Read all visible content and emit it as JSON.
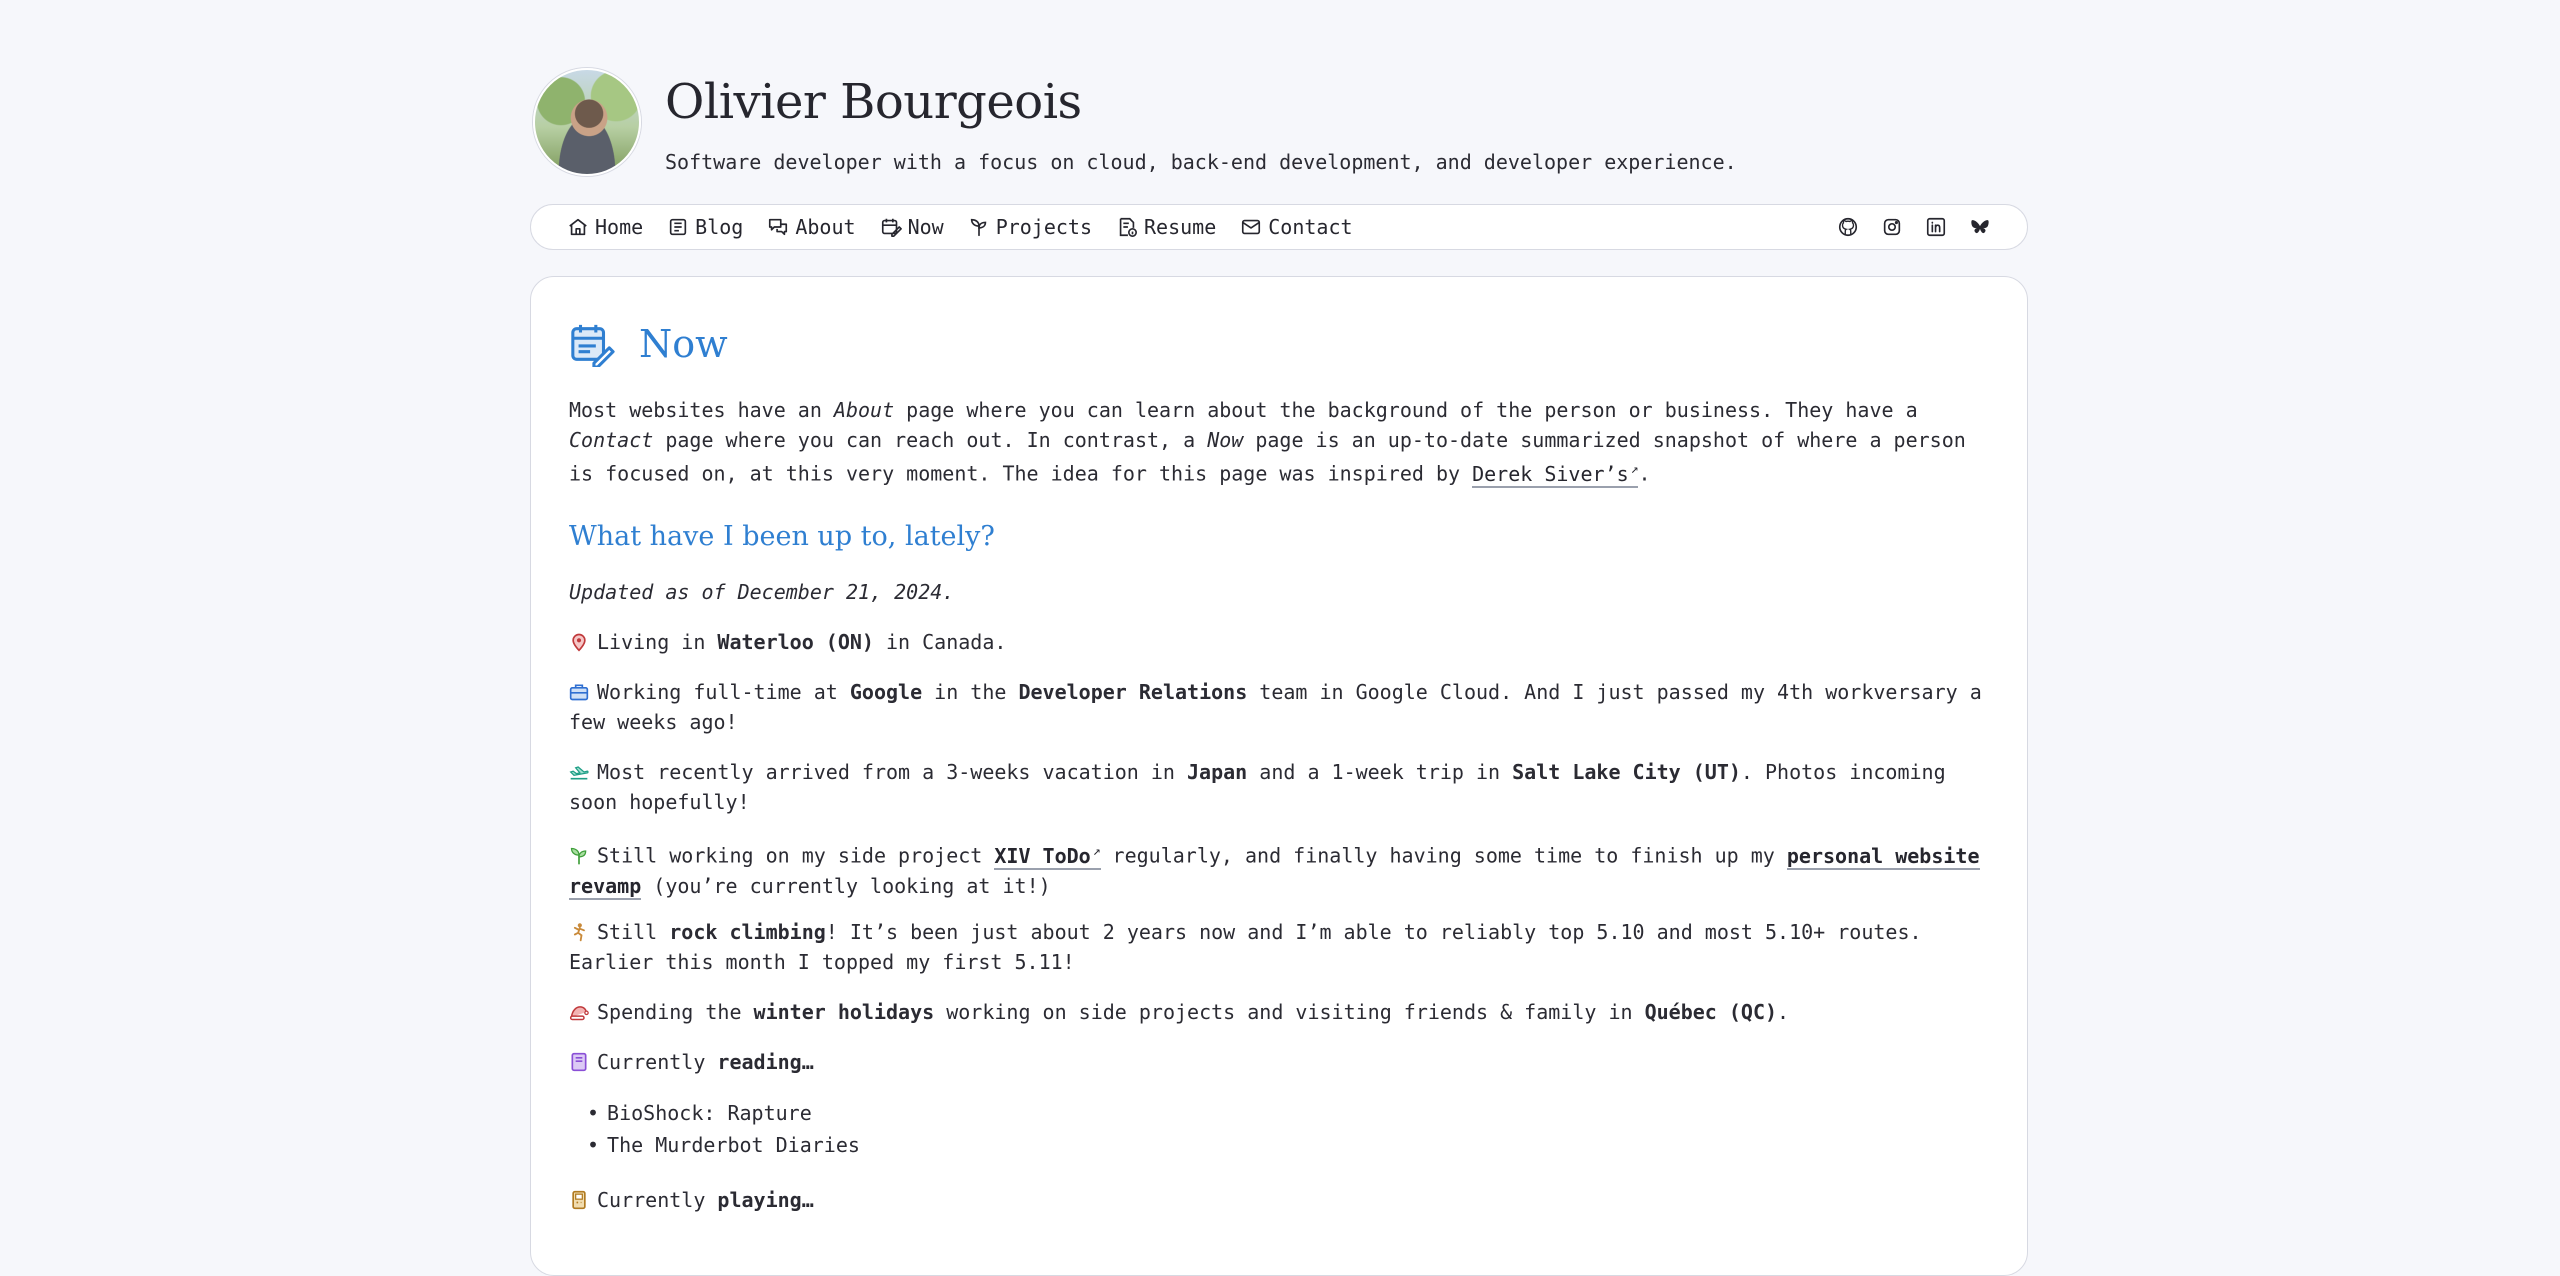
{
  "header": {
    "name": "Olivier Bourgeois",
    "tagline": "Software developer with a focus on cloud, back-end development, and developer experience."
  },
  "nav": {
    "items": [
      {
        "label": "Home",
        "icon": "home-icon"
      },
      {
        "label": "Blog",
        "icon": "newspaper-icon"
      },
      {
        "label": "About",
        "icon": "chat-bubbles-icon"
      },
      {
        "label": "Now",
        "icon": "calendar-pen-icon"
      },
      {
        "label": "Projects",
        "icon": "sprout-icon"
      },
      {
        "label": "Resume",
        "icon": "document-info-icon"
      },
      {
        "label": "Contact",
        "icon": "mail-icon"
      }
    ],
    "socials": [
      "github-icon",
      "instagram-icon",
      "linkedin-icon",
      "bluesky-icon"
    ]
  },
  "page": {
    "title": "Now",
    "intro_1": "Most websites have an ",
    "intro_about": "About",
    "intro_2": " page where you can learn about the background of the person or business. They have a ",
    "intro_contact": "Contact",
    "intro_3": " page where you can reach out. In contrast, a ",
    "intro_now": "Now",
    "intro_4": " page is an up-to-date summarized snapshot of where a person is focused on, at this very moment. The idea for this page was inspired by ",
    "intro_link": "Derek Siver’s",
    "intro_5": ".",
    "subtitle": "What have I been up to, lately?",
    "updated": "Updated as of December 21, 2024."
  },
  "items": {
    "living": {
      "a": "Living in ",
      "b": "Waterloo (ON)",
      "c": " in Canada."
    },
    "working": {
      "a": "Working full-time at ",
      "b": "Google",
      "c": " in the ",
      "d": "Developer Relations",
      "e": " team in Google Cloud. And I just passed my 4th workversary a few weeks ago!"
    },
    "travel": {
      "a": "Most recently arrived from a 3-weeks vacation in ",
      "b": "Japan",
      "c": " and a 1-week trip in ",
      "d": "Salt Lake City (UT)",
      "e": ". Photos incoming soon hopefully!"
    },
    "project": {
      "a": "Still working on my side project ",
      "b": "XIV ToDo",
      "c": " regularly, and finally having some time to finish up my ",
      "d": "personal website revamp",
      "e": " (you’re currently looking at it!)"
    },
    "climbing": {
      "a": "Still ",
      "b": "rock climbing",
      "c": "! It’s been just about 2 years now and I’m able to reliably top 5.10 and most 5.10+ routes. Earlier this month I topped my first 5.11!"
    },
    "holidays": {
      "a": "Spending the ",
      "b": "winter holidays",
      "c": " working on side projects and visiting friends & family in ",
      "d": "Québec (QC)",
      "e": "."
    },
    "reading": {
      "a": "Currently ",
      "b": "reading…",
      "books": [
        "BioShock: Rapture",
        "The Murderbot Diaries"
      ]
    },
    "playing": {
      "a": "Currently ",
      "b": "playing…"
    }
  },
  "colors": {
    "accent": "#2f7fd1",
    "background": "#f6f7fb"
  }
}
